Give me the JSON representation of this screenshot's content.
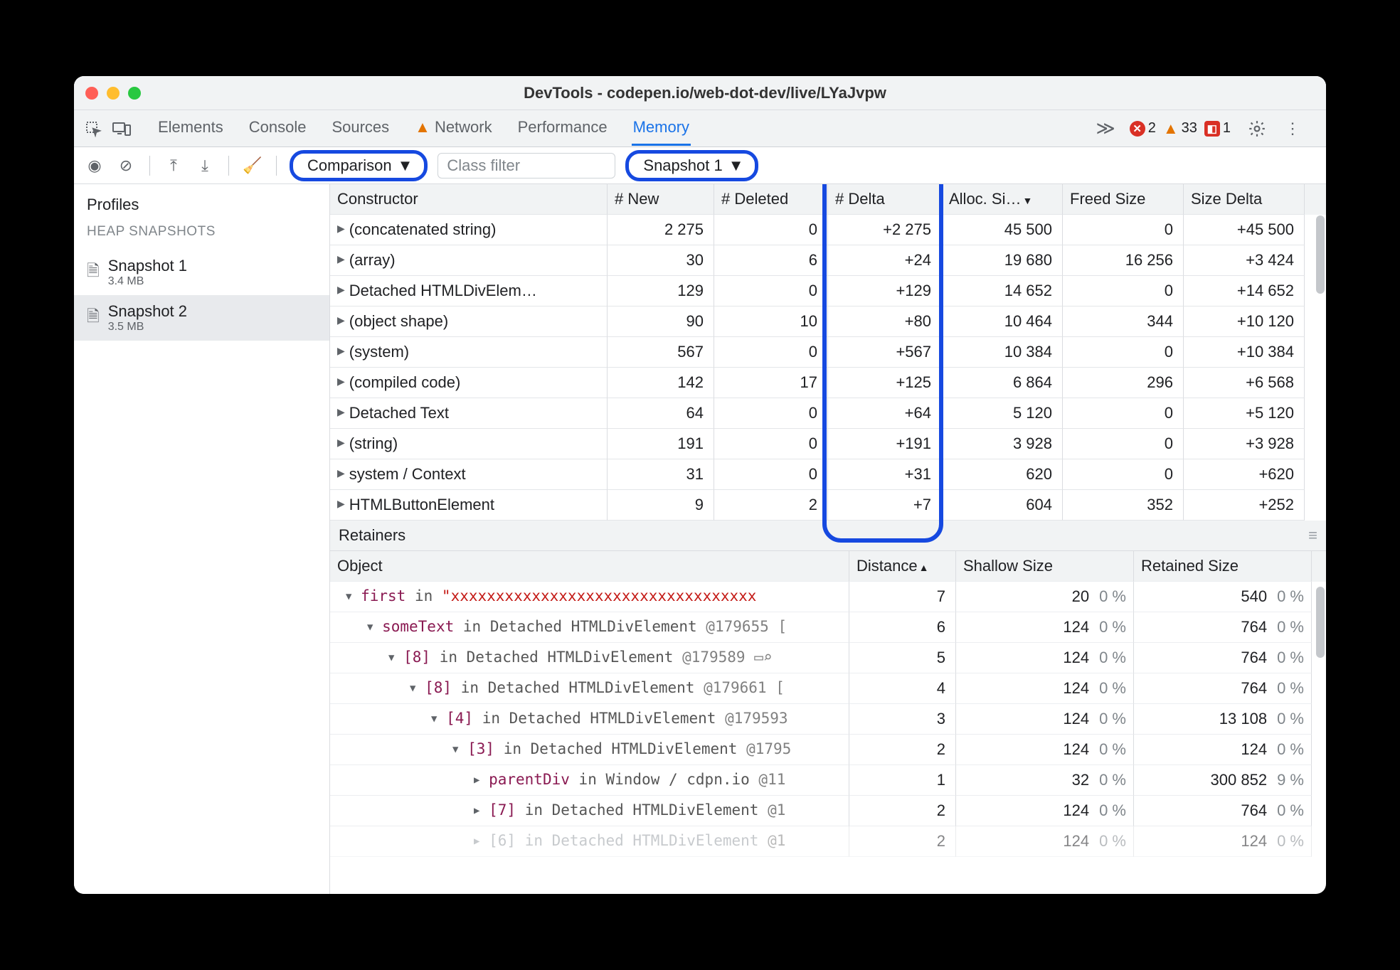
{
  "window": {
    "title": "DevTools - codepen.io/web-dot-dev/live/LYaJvpw"
  },
  "tabstrip": {
    "tabs": [
      "Elements",
      "Console",
      "Sources",
      "Network",
      "Performance",
      "Memory"
    ],
    "active": "Memory",
    "more": "≫",
    "err_count": "2",
    "warn_count": "33",
    "issue_count": "1"
  },
  "toolbar": {
    "mode_label": "Comparison",
    "filter_placeholder": "Class filter",
    "against_label": "Snapshot 1"
  },
  "sidebar": {
    "title": "Profiles",
    "heading": "HEAP SNAPSHOTS",
    "items": [
      {
        "name": "Snapshot 1",
        "size": "3.4 MB"
      },
      {
        "name": "Snapshot 2",
        "size": "3.5 MB"
      }
    ],
    "active_index": 1
  },
  "headers": [
    "Constructor",
    "# New",
    "# Deleted",
    "# Delta",
    "Alloc. Si…",
    "Freed Size",
    "Size Delta"
  ],
  "sort_col": 4,
  "rows": [
    {
      "c": "(concatenated string)",
      "new": "2 275",
      "del": "0",
      "delta": "+2 275",
      "alloc": "45 500",
      "freed": "0",
      "sd": "+45 500"
    },
    {
      "c": "(array)",
      "new": "30",
      "del": "6",
      "delta": "+24",
      "alloc": "19 680",
      "freed": "16 256",
      "sd": "+3 424"
    },
    {
      "c": "Detached HTMLDivElem…",
      "new": "129",
      "del": "0",
      "delta": "+129",
      "alloc": "14 652",
      "freed": "0",
      "sd": "+14 652"
    },
    {
      "c": "(object shape)",
      "new": "90",
      "del": "10",
      "delta": "+80",
      "alloc": "10 464",
      "freed": "344",
      "sd": "+10 120"
    },
    {
      "c": "(system)",
      "new": "567",
      "del": "0",
      "delta": "+567",
      "alloc": "10 384",
      "freed": "0",
      "sd": "+10 384"
    },
    {
      "c": "(compiled code)",
      "new": "142",
      "del": "17",
      "delta": "+125",
      "alloc": "6 864",
      "freed": "296",
      "sd": "+6 568"
    },
    {
      "c": "Detached Text",
      "new": "64",
      "del": "0",
      "delta": "+64",
      "alloc": "5 120",
      "freed": "0",
      "sd": "+5 120"
    },
    {
      "c": "(string)",
      "new": "191",
      "del": "0",
      "delta": "+191",
      "alloc": "3 928",
      "freed": "0",
      "sd": "+3 928"
    },
    {
      "c": "system / Context",
      "new": "31",
      "del": "0",
      "delta": "+31",
      "alloc": "620",
      "freed": "0",
      "sd": "+620"
    },
    {
      "c": "HTMLButtonElement",
      "new": "9",
      "del": "2",
      "delta": "+7",
      "alloc": "604",
      "freed": "352",
      "sd": "+252"
    }
  ],
  "retainers": {
    "title": "Retainers",
    "headers": [
      "Object",
      "Distance",
      "Shallow Size",
      "Retained Size"
    ],
    "sort_col": 1,
    "rows": [
      {
        "indent": 0,
        "open": true,
        "prop": "first",
        "tail": "in",
        "str": "\"xxxxxxxxxxxxxxxxxxxxxxxxxxxxxxxxxx",
        "id": "",
        "dist": "7",
        "sh": "20",
        "shp": "0 %",
        "ret": "540",
        "retp": "0 %"
      },
      {
        "indent": 1,
        "open": true,
        "prop": "someText",
        "tail": "in Detached HTMLDivElement",
        "str": "",
        "id": "@179655 [",
        "dist": "6",
        "sh": "124",
        "shp": "0 %",
        "ret": "764",
        "retp": "0 %"
      },
      {
        "indent": 2,
        "open": true,
        "prop": "[8]",
        "tail": "in Detached HTMLDivElement",
        "str": "",
        "id": "@179589 ▭⌕",
        "dist": "5",
        "sh": "124",
        "shp": "0 %",
        "ret": "764",
        "retp": "0 %"
      },
      {
        "indent": 3,
        "open": true,
        "prop": "[8]",
        "tail": "in Detached HTMLDivElement",
        "str": "",
        "id": "@179661 [",
        "dist": "4",
        "sh": "124",
        "shp": "0 %",
        "ret": "764",
        "retp": "0 %"
      },
      {
        "indent": 4,
        "open": true,
        "prop": "[4]",
        "tail": "in Detached HTMLDivElement",
        "str": "",
        "id": "@179593",
        "dist": "3",
        "sh": "124",
        "shp": "0 %",
        "ret": "13 108",
        "retp": "0 %"
      },
      {
        "indent": 5,
        "open": true,
        "prop": "[3]",
        "tail": "in Detached HTMLDivElement",
        "str": "",
        "id": "@1795",
        "dist": "2",
        "sh": "124",
        "shp": "0 %",
        "ret": "124",
        "retp": "0 %"
      },
      {
        "indent": 6,
        "open": false,
        "prop": "parentDiv",
        "tail": "in Window / cdpn.io",
        "str": "",
        "id": "@11",
        "dist": "1",
        "sh": "32",
        "shp": "0 %",
        "ret": "300 852",
        "retp": "9 %"
      },
      {
        "indent": 6,
        "open": false,
        "prop": "[7]",
        "tail": "in Detached HTMLDivElement",
        "str": "",
        "id": "@1",
        "dist": "2",
        "sh": "124",
        "shp": "0 %",
        "ret": "764",
        "retp": "0 %"
      },
      {
        "indent": 6,
        "open": false,
        "prop": "[6]",
        "tail": "in Detached HTMLDivElement",
        "str": "",
        "id": "@1",
        "dist": "2",
        "sh": "124",
        "shp": "0 %",
        "ret": "124",
        "retp": "0 %",
        "dim": true
      }
    ]
  }
}
